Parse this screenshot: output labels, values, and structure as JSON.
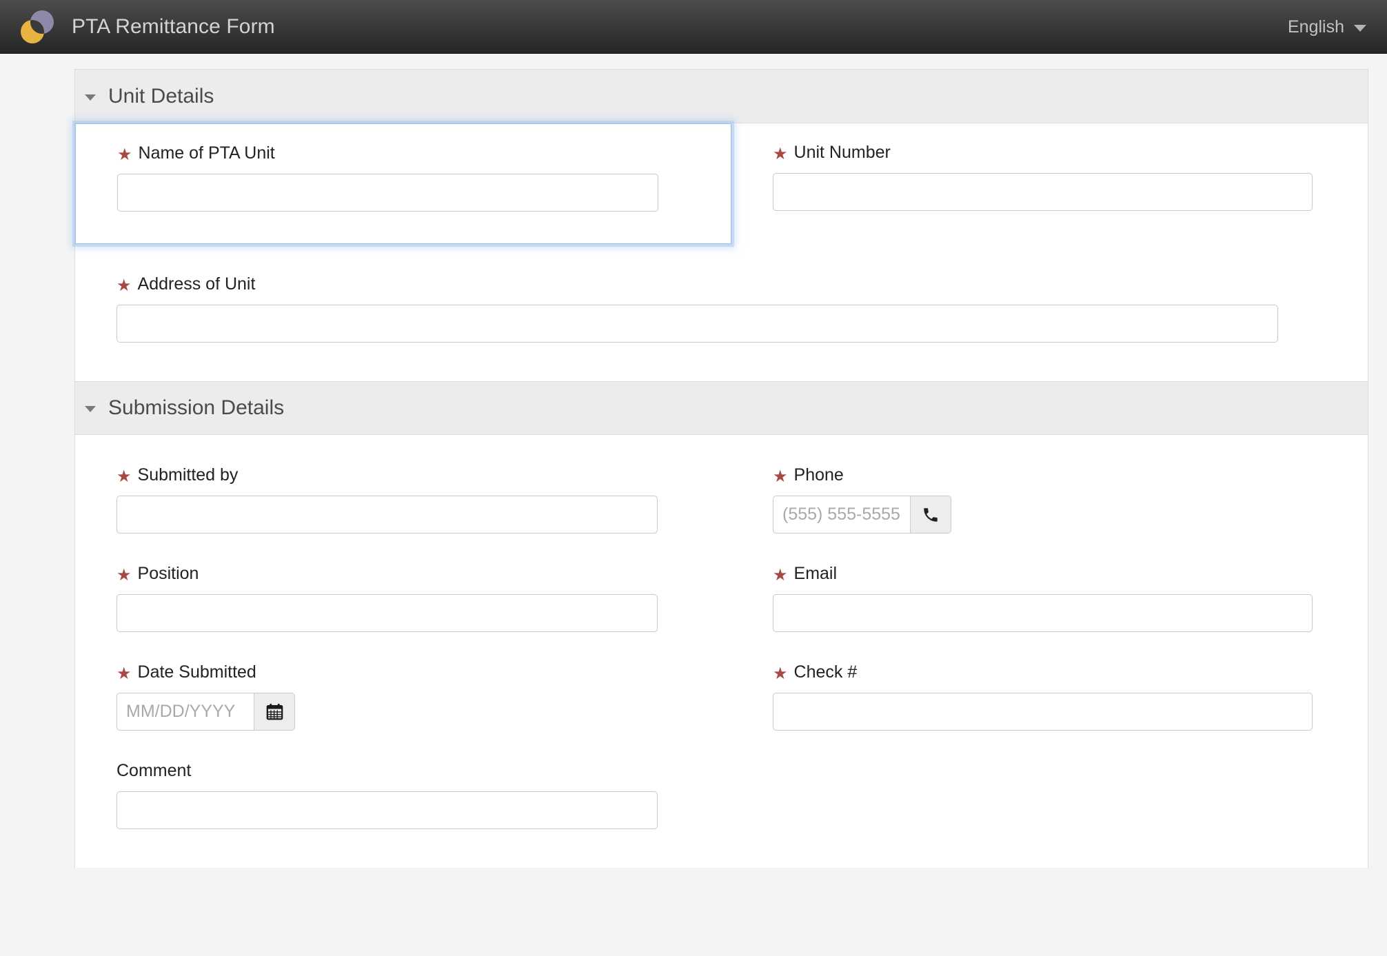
{
  "header": {
    "app_title": "PTA Remittance Form",
    "logo_name": "overlapping-circles-logo",
    "language": "English"
  },
  "sections": [
    {
      "title": "Unit Details",
      "fields": [
        {
          "label": "Name of PTA Unit",
          "required": true,
          "value": "",
          "placeholder": "",
          "kind": "text",
          "focused": true
        },
        {
          "label": "Unit Number",
          "required": true,
          "value": "",
          "placeholder": "",
          "kind": "text"
        },
        {
          "label": "Address of Unit",
          "required": true,
          "value": "",
          "placeholder": "",
          "kind": "text"
        }
      ]
    },
    {
      "title": "Submission Details",
      "fields": [
        {
          "label": "Submitted by",
          "required": true,
          "value": "",
          "placeholder": "",
          "kind": "text"
        },
        {
          "label": "Phone",
          "required": true,
          "value": "",
          "placeholder": "(555) 555-5555",
          "kind": "phone",
          "addon_icon": "phone-icon"
        },
        {
          "label": "Position",
          "required": true,
          "value": "",
          "placeholder": "",
          "kind": "text"
        },
        {
          "label": "Email",
          "required": true,
          "value": "",
          "placeholder": "",
          "kind": "email"
        },
        {
          "label": "Date Submitted",
          "required": true,
          "value": "",
          "placeholder": "MM/DD/YYYY",
          "kind": "date",
          "addon_icon": "calendar-icon"
        },
        {
          "label": "Check #",
          "required": true,
          "value": "",
          "placeholder": "",
          "kind": "text"
        },
        {
          "label": "Comment",
          "required": false,
          "value": "",
          "placeholder": "",
          "kind": "text"
        }
      ]
    }
  ],
  "symbols": {
    "required_marker": "★",
    "collapse_caret": "▾"
  },
  "colors": {
    "required_star": "#a64b43",
    "header_bar_top": "#4d4d4d",
    "header_bar_bottom": "#262626",
    "section_header_bg": "#ececec",
    "page_bg": "#f4f4f4",
    "focus_glow": "#a4c5eb",
    "logo_purple": "#8d89a8",
    "logo_yellow": "#e8b341"
  }
}
